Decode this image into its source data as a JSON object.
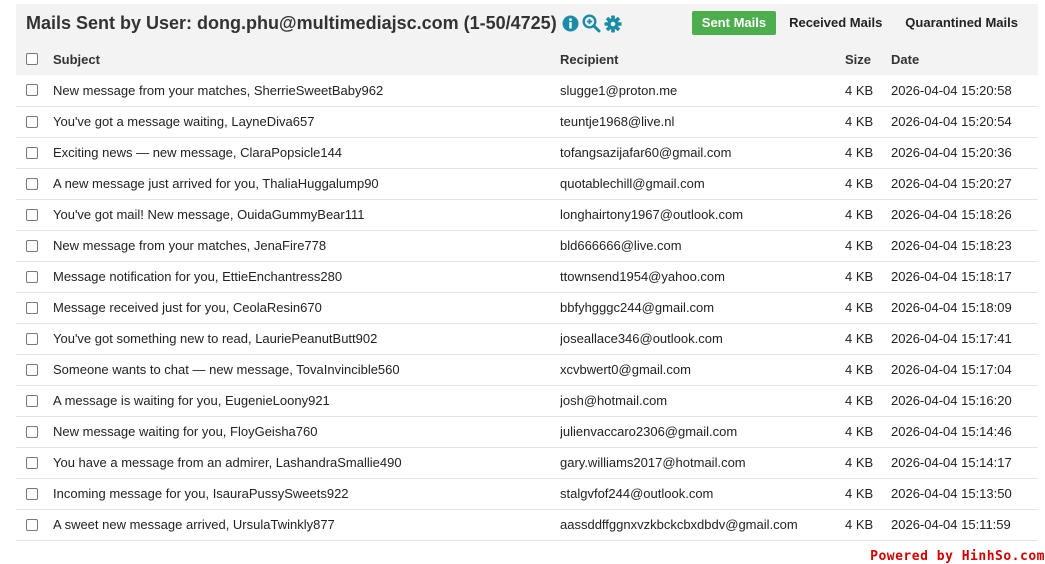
{
  "header": {
    "title": "Mails Sent by User: dong.phu@multimediajsc.com (1-50/4725)",
    "icons": [
      "info-icon",
      "zoom-in-icon",
      "gear-icon"
    ]
  },
  "tabs": [
    {
      "label": "Sent Mails",
      "active": true
    },
    {
      "label": "Received Mails",
      "active": false
    },
    {
      "label": "Quarantined Mails",
      "active": false
    }
  ],
  "table": {
    "columns": [
      "Subject",
      "Recipient",
      "Size",
      "Date"
    ],
    "rows": [
      {
        "subject": "New message from your matches, SherrieSweetBaby962",
        "recipient": "slugge1@proton.me",
        "size": "4 KB",
        "date": "2026-04-04 15:20:58"
      },
      {
        "subject": "You've got a message waiting, LayneDiva657",
        "recipient": "teuntje1968@live.nl",
        "size": "4 KB",
        "date": "2026-04-04 15:20:54"
      },
      {
        "subject": "Exciting news — new message, ClaraPopsicle144",
        "recipient": "tofangsazijafar60@gmail.com",
        "size": "4 KB",
        "date": "2026-04-04 15:20:36"
      },
      {
        "subject": "A new message just arrived for you, ThaliaHuggalump90",
        "recipient": "quotablechill@gmail.com",
        "size": "4 KB",
        "date": "2026-04-04 15:20:27"
      },
      {
        "subject": "You've got mail! New message, OuidaGummyBear111",
        "recipient": "longhairtony1967@outlook.com",
        "size": "4 KB",
        "date": "2026-04-04 15:18:26"
      },
      {
        "subject": "New message from your matches, JenaFire778",
        "recipient": "bld666666@live.com",
        "size": "4 KB",
        "date": "2026-04-04 15:18:23"
      },
      {
        "subject": "Message notification for you, EttieEnchantress280",
        "recipient": "ttownsend1954@yahoo.com",
        "size": "4 KB",
        "date": "2026-04-04 15:18:17"
      },
      {
        "subject": "Message received just for you, CeolaResin670",
        "recipient": "bbfyhgggc244@gmail.com",
        "size": "4 KB",
        "date": "2026-04-04 15:18:09"
      },
      {
        "subject": "You've got something new to read, LauriePeanutButt902",
        "recipient": "joseallace346@outlook.com",
        "size": "4 KB",
        "date": "2026-04-04 15:17:41"
      },
      {
        "subject": "Someone wants to chat — new message, TovaInvincible560",
        "recipient": "xcvbwert0@gmail.com",
        "size": "4 KB",
        "date": "2026-04-04 15:17:04"
      },
      {
        "subject": "A message is waiting for you, EugenieLoony921",
        "recipient": "josh@hotmail.com",
        "size": "4 KB",
        "date": "2026-04-04 15:16:20"
      },
      {
        "subject": "New message waiting for you, FloyGeisha760",
        "recipient": "julienvaccaro2306@gmail.com",
        "size": "4 KB",
        "date": "2026-04-04 15:14:46"
      },
      {
        "subject": "You have a message from an admirer, LashandraSmallie490",
        "recipient": "gary.williams2017@hotmail.com",
        "size": "4 KB",
        "date": "2026-04-04 15:14:17"
      },
      {
        "subject": "Incoming message for you, IsauraPussySweets922",
        "recipient": "stalgvfof244@outlook.com",
        "size": "4 KB",
        "date": "2026-04-04 15:13:50"
      },
      {
        "subject": "A sweet new message arrived, UrsulaTwinkly877",
        "recipient": "aassddffggnxvzkbckcbxdbdv@gmail.com",
        "size": "4 KB",
        "date": "2026-04-04 15:11:59"
      }
    ]
  },
  "footer": {
    "powered": "Powered by HinhSo.com"
  },
  "colors": {
    "active_tab": "#4cae4c",
    "header_bg": "#f3f3f3",
    "icon_teal": "#1a8ca8",
    "powered_red": "#d40000"
  }
}
